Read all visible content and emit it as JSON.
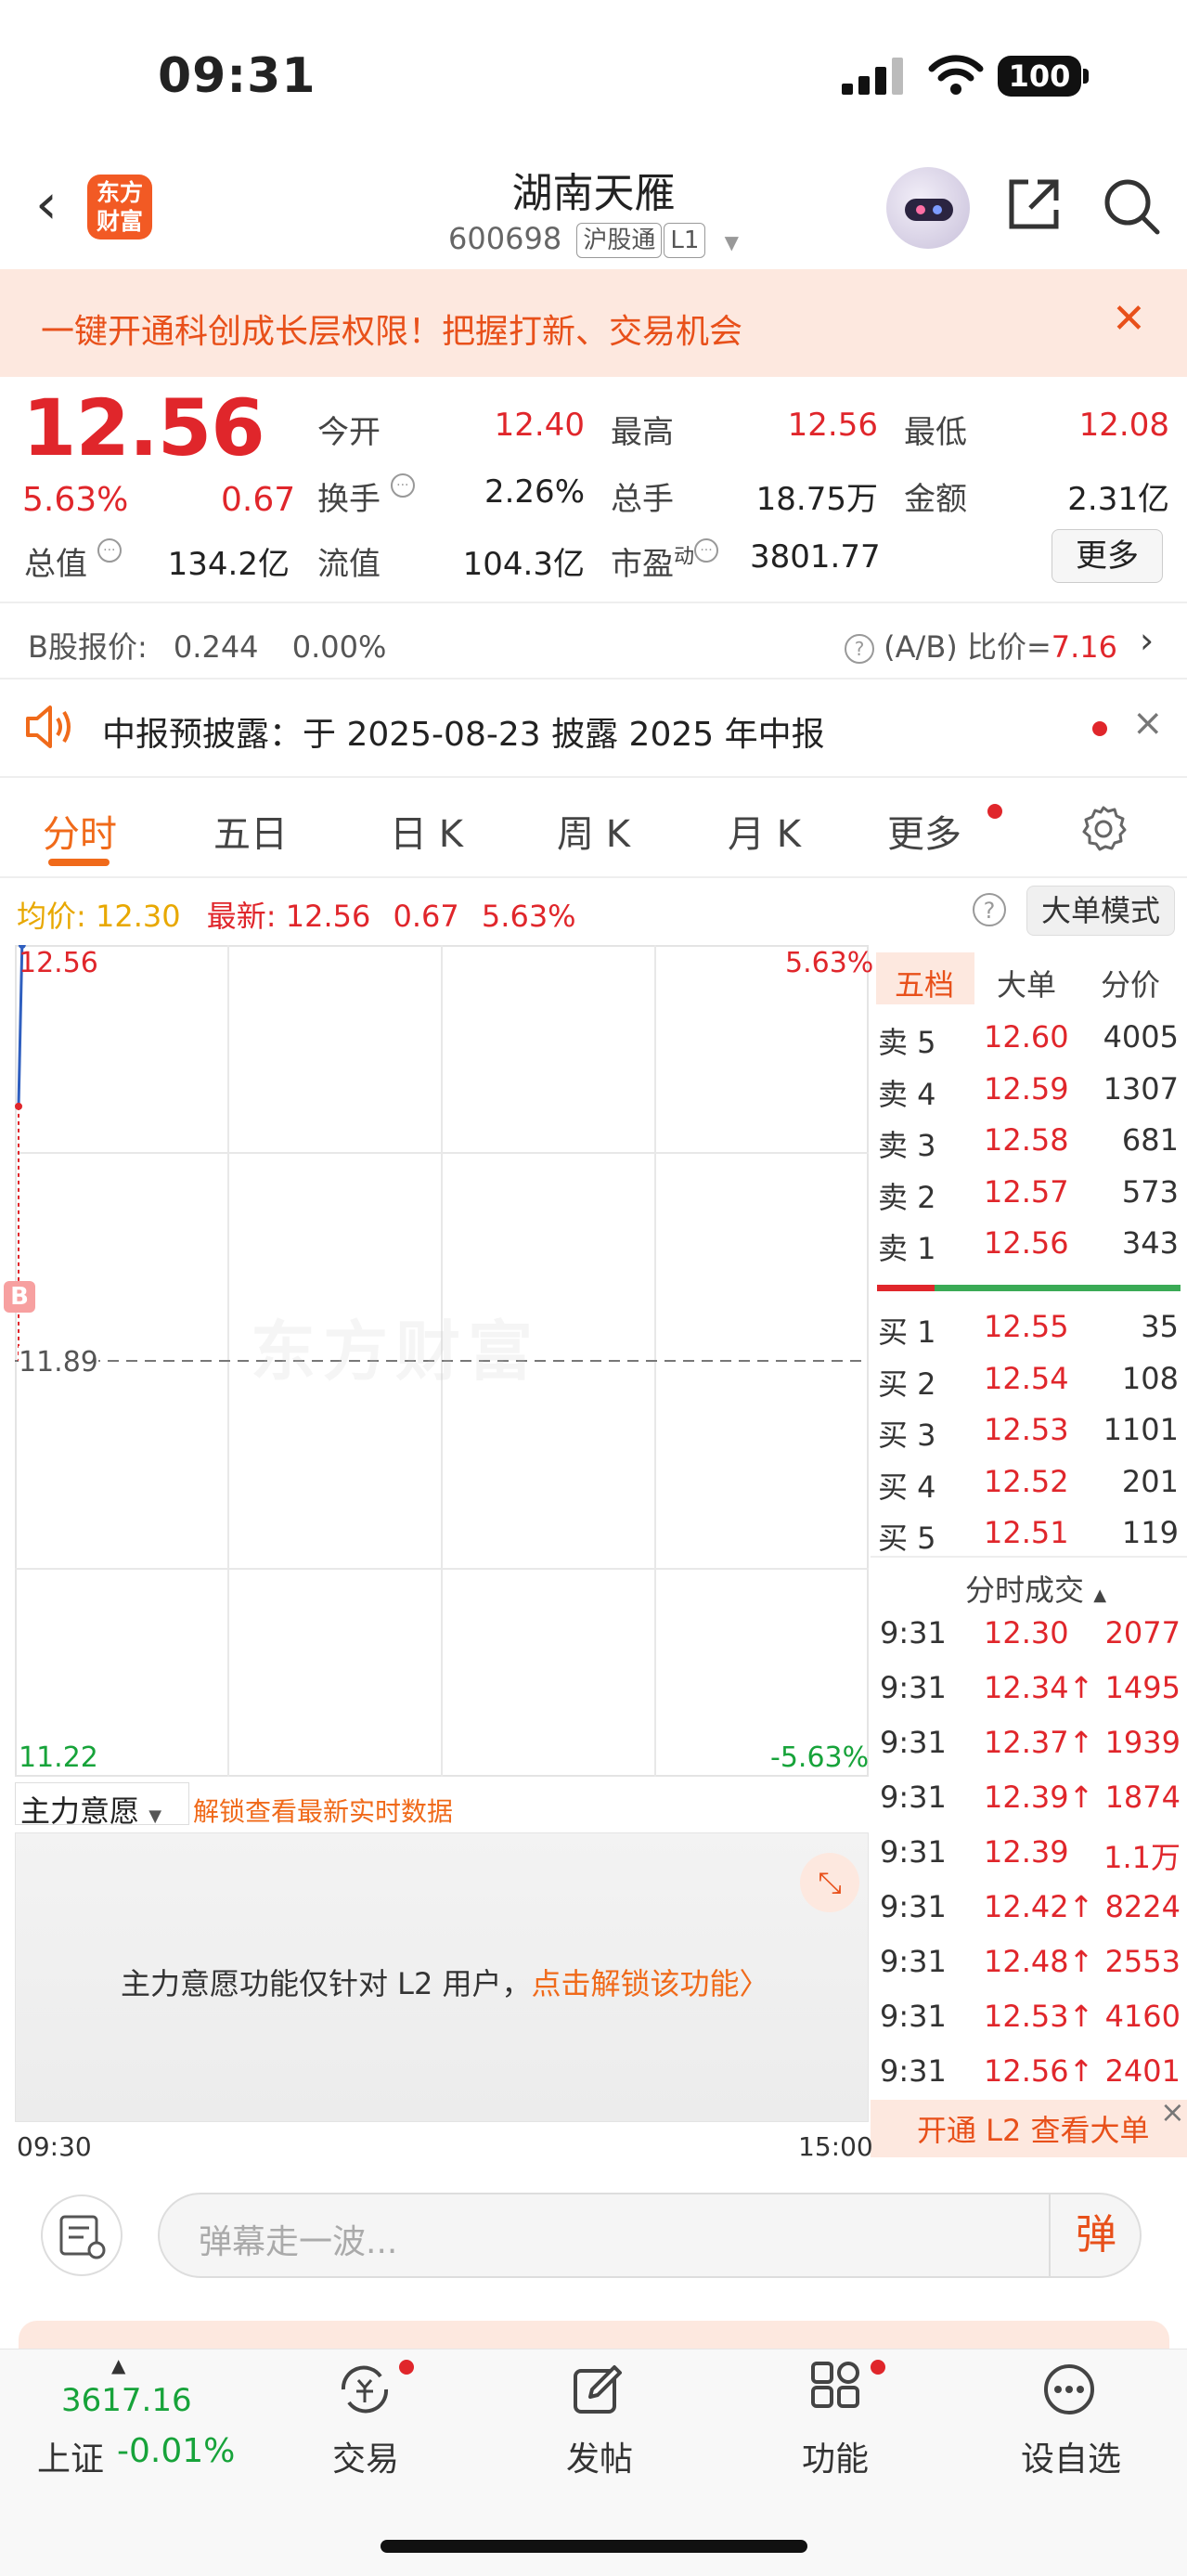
{
  "status_bar": {
    "time": "09:31",
    "battery": "100"
  },
  "header": {
    "logo_text_line1": "东方",
    "logo_text_line2": "财富",
    "stock_name": "湖南天雁",
    "stock_code": "600698",
    "tag_connect": "沪股通",
    "tag_level": "L1"
  },
  "banner": {
    "text": "一键开通科创成长层权限！把握打新、交易机会",
    "close": "✕"
  },
  "quote": {
    "price": "12.56",
    "change_pct": "5.63%",
    "change": "0.67",
    "fields": {
      "open_label": "今开",
      "open": "12.40",
      "high_label": "最高",
      "high": "12.56",
      "low_label": "最低",
      "low": "12.08",
      "turnover_label": "换手",
      "turnover": "2.26%",
      "volume_label": "总手",
      "volume": "18.75万",
      "amount_label": "金额",
      "amount": "2.31亿",
      "mktcap_label": "总值",
      "mktcap": "134.2亿",
      "float_label": "流值",
      "float": "104.3亿",
      "pe_label": "市盈",
      "pe_sup": "动",
      "pe": "3801.77"
    },
    "more_button": "更多"
  },
  "bshare": {
    "label": "B股报价:",
    "price": "0.244",
    "pct": "0.00%",
    "ratio_label": "(A/B) 比价=",
    "ratio": "7.16"
  },
  "notice": {
    "text": "中报预披露：于 2025-08-23 披露 2025 年中报"
  },
  "tabs": [
    "分时",
    "五日",
    "日 K",
    "周 K",
    "月 K",
    "更多"
  ],
  "infoline": {
    "avg_label": "均价:",
    "avg": "12.30",
    "latest_label": "最新:",
    "latest": "12.56",
    "change": "0.67",
    "pct": "5.63%",
    "bigorder_button": "大单模式"
  },
  "chart_data": {
    "type": "line",
    "title": "",
    "y_top_label": "12.56",
    "y_mid_label": "11.89",
    "y_bottom_label": "11.22",
    "right_top_label": "5.63%",
    "right_bottom_label": "-5.63%",
    "ylim": [
      11.22,
      12.56
    ],
    "prev_close": 11.89,
    "x_start": "09:30",
    "x_end": "15:00",
    "series": [
      {
        "name": "",
        "x": [
          "09:30",
          "09:31"
        ],
        "values": [
          12.3,
          12.56
        ]
      }
    ],
    "watermark": "东方财富",
    "buy_marker": "B"
  },
  "orderbook": {
    "tabs": [
      "五档",
      "大单",
      "分价"
    ],
    "asks": [
      {
        "label": "卖 5",
        "price": "12.60",
        "vol": "4005"
      },
      {
        "label": "卖 4",
        "price": "12.59",
        "vol": "1307"
      },
      {
        "label": "卖 3",
        "price": "12.58",
        "vol": "681"
      },
      {
        "label": "卖 2",
        "price": "12.57",
        "vol": "573"
      },
      {
        "label": "卖 1",
        "price": "12.56",
        "vol": "343"
      }
    ],
    "bids": [
      {
        "label": "买 1",
        "price": "12.55",
        "vol": "35"
      },
      {
        "label": "买 2",
        "price": "12.54",
        "vol": "108"
      },
      {
        "label": "买 3",
        "price": "12.53",
        "vol": "1101"
      },
      {
        "label": "买 4",
        "price": "12.52",
        "vol": "201"
      },
      {
        "label": "买 5",
        "price": "12.51",
        "vol": "119"
      }
    ],
    "trades_title": "分时成交",
    "trades": [
      {
        "time": "9:31",
        "price": "12.30",
        "vol": "2077"
      },
      {
        "time": "9:31",
        "price": "12.34↑",
        "vol": "1495"
      },
      {
        "time": "9:31",
        "price": "12.37↑",
        "vol": "1939"
      },
      {
        "time": "9:31",
        "price": "12.39↑",
        "vol": "1874"
      },
      {
        "time": "9:31",
        "price": "12.39",
        "vol": "1.1万"
      },
      {
        "time": "9:31",
        "price": "12.42↑",
        "vol": "8224"
      },
      {
        "time": "9:31",
        "price": "12.48↑",
        "vol": "2553"
      },
      {
        "time": "9:31",
        "price": "12.53↑",
        "vol": "4160"
      },
      {
        "time": "9:31",
        "price": "12.56↑",
        "vol": "2401"
      }
    ],
    "l2_banner": "开通 L2 查看大单"
  },
  "main_force": {
    "label": "主力意愿",
    "unlock_link": "解锁查看最新实时数据",
    "panel_text": "主力意愿功能仅针对 L2 用户，",
    "panel_link": "点击解锁该功能〉"
  },
  "comment": {
    "placeholder": "弹幕走一波...",
    "danmu_button": "弹"
  },
  "bottom_nav": {
    "index_value": "3617.16",
    "index_name": "上证",
    "index_change": "-0.01%",
    "items": [
      "交易",
      "发帖",
      "功能",
      "设自选"
    ]
  }
}
